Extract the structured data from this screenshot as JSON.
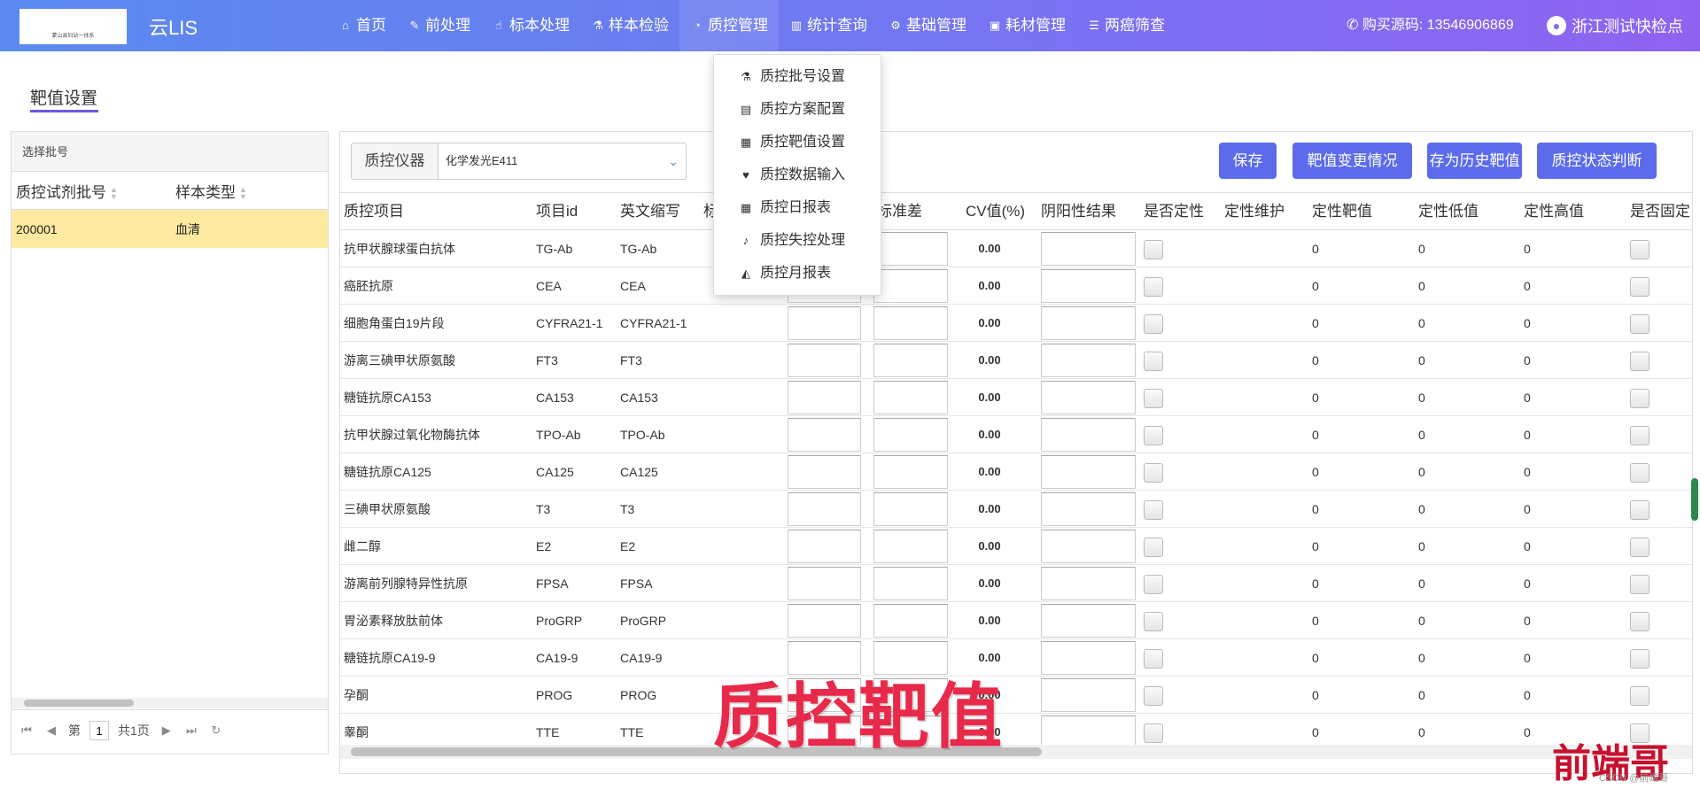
{
  "header": {
    "logo_text": "蒙山县妇幼一体系",
    "app_title": "云LIS",
    "nav": [
      {
        "icon": "home-icon",
        "glyph": "⌂",
        "label": "首页"
      },
      {
        "icon": "wrench-icon",
        "glyph": "✎",
        "label": "前处理"
      },
      {
        "icon": "hand-icon",
        "glyph": "☝",
        "label": "标本处理"
      },
      {
        "icon": "flask-icon",
        "glyph": "⚗",
        "label": "样本检验"
      },
      {
        "icon": "pie-chart-icon",
        "glyph": "◔",
        "label": "质控管理"
      },
      {
        "icon": "bar-chart-icon",
        "glyph": "▥",
        "label": "统计查询"
      },
      {
        "icon": "gear-icon",
        "glyph": "⚙",
        "label": "基础管理"
      },
      {
        "icon": "briefcase-icon",
        "glyph": "▣",
        "label": "耗材管理"
      },
      {
        "icon": "list-icon",
        "glyph": "☰",
        "label": "两癌筛查"
      }
    ],
    "phone": "✆ 购买源码: 13546906869",
    "user": "浙江测试快检点"
  },
  "dropdown": [
    {
      "icon": "flask-icon",
      "glyph": "⚗",
      "label": "质控批号设置"
    },
    {
      "icon": "document-icon",
      "glyph": "▤",
      "label": "质控方案配置"
    },
    {
      "icon": "target-icon",
      "glyph": "▦",
      "label": "质控靶值设置"
    },
    {
      "icon": "heart-icon",
      "glyph": "♥",
      "label": "质控数据输入"
    },
    {
      "icon": "calendar-icon",
      "glyph": "▦",
      "label": "质控日报表"
    },
    {
      "icon": "bell-icon",
      "glyph": "♪",
      "label": "质控失控处理"
    },
    {
      "icon": "area-chart-icon",
      "glyph": "◭",
      "label": "质控月报表"
    }
  ],
  "page": {
    "title": "靶值设置"
  },
  "left_panel": {
    "header": "选择批号",
    "columns": [
      "质控试剂批号",
      "样本类型"
    ],
    "rows": [
      {
        "batch": "200001",
        "type": "血清"
      }
    ],
    "pager": {
      "first": "⏮",
      "prev": "◀",
      "page_prefix": "第",
      "page": "1",
      "page_total": "共1页",
      "next": "▶",
      "last": "⏭",
      "refresh": "↻"
    }
  },
  "toolbar": {
    "instrument_label": "质控仪器",
    "instrument_value": "化学发光E411",
    "buttons": [
      "保存",
      "靶值变更情况",
      "存为历史靶值",
      "质控状态判断"
    ]
  },
  "grid": {
    "columns": [
      "质控项目",
      "项目id",
      "英文缩写",
      "标",
      "标准差",
      "CV值(%)",
      "阴阳性结果",
      "是否定性",
      "定性维护",
      "定性靶值",
      "定性低值",
      "定性高值",
      "是否固定"
    ],
    "rows": [
      {
        "name": "抗甲状腺球蛋白抗体",
        "id": "TG-Ab",
        "abbr": "TG-Ab",
        "cv": "0.00",
        "q_target": "0",
        "q_low": "0",
        "q_high": "0"
      },
      {
        "name": "癌胚抗原",
        "id": "CEA",
        "abbr": "CEA",
        "cv": "0.00",
        "q_target": "0",
        "q_low": "0",
        "q_high": "0"
      },
      {
        "name": "细胞角蛋白19片段",
        "id": "CYFRA21-1",
        "abbr": "CYFRA21-1",
        "cv": "0.00",
        "q_target": "0",
        "q_low": "0",
        "q_high": "0"
      },
      {
        "name": "游离三碘甲状原氨酸",
        "id": "FT3",
        "abbr": "FT3",
        "cv": "0.00",
        "q_target": "0",
        "q_low": "0",
        "q_high": "0"
      },
      {
        "name": "糖链抗原CA153",
        "id": "CA153",
        "abbr": "CA153",
        "cv": "0.00",
        "q_target": "0",
        "q_low": "0",
        "q_high": "0"
      },
      {
        "name": "抗甲状腺过氧化物酶抗体",
        "id": "TPO-Ab",
        "abbr": "TPO-Ab",
        "cv": "0.00",
        "q_target": "0",
        "q_low": "0",
        "q_high": "0"
      },
      {
        "name": "糖链抗原CA125",
        "id": "CA125",
        "abbr": "CA125",
        "cv": "0.00",
        "q_target": "0",
        "q_low": "0",
        "q_high": "0"
      },
      {
        "name": "三碘甲状原氨酸",
        "id": "T3",
        "abbr": "T3",
        "cv": "0.00",
        "q_target": "0",
        "q_low": "0",
        "q_high": "0"
      },
      {
        "name": "雌二醇",
        "id": "E2",
        "abbr": "E2",
        "cv": "0.00",
        "q_target": "0",
        "q_low": "0",
        "q_high": "0"
      },
      {
        "name": "游离前列腺特异性抗原",
        "id": "FPSA",
        "abbr": "FPSA",
        "cv": "0.00",
        "q_target": "0",
        "q_low": "0",
        "q_high": "0"
      },
      {
        "name": "胃泌素释放肽前体",
        "id": "ProGRP",
        "abbr": "ProGRP",
        "cv": "0.00",
        "q_target": "0",
        "q_low": "0",
        "q_high": "0"
      },
      {
        "name": "糖链抗原CA19-9",
        "id": "CA19-9",
        "abbr": "CA19-9",
        "cv": "0.00",
        "q_target": "0",
        "q_low": "0",
        "q_high": "0"
      },
      {
        "name": "孕酮",
        "id": "PROG",
        "abbr": "PROG",
        "cv": "0.00",
        "q_target": "0",
        "q_low": "0",
        "q_high": "0"
      },
      {
        "name": "睾酮",
        "id": "TTE",
        "abbr": "TTE",
        "cv": "0.00",
        "q_target": "0",
        "q_low": "0",
        "q_high": "0"
      }
    ]
  },
  "overlay": {
    "watermark": "质控靶值",
    "brand": "前端哥",
    "credit": "CSDN @前端哥"
  }
}
